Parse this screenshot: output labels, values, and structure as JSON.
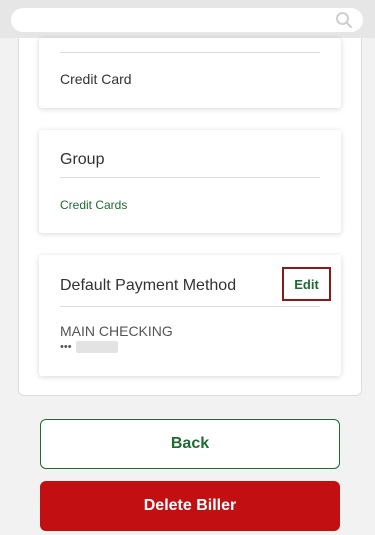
{
  "search": {
    "placeholder": ""
  },
  "category_card": {
    "value": "Credit Card"
  },
  "group_card": {
    "heading": "Group",
    "value": "Credit Cards"
  },
  "payment_card": {
    "heading": "Default Payment Method",
    "edit_label": "Edit",
    "account_name": "MAIN CHECKING",
    "account_mask": "•••"
  },
  "actions": {
    "back_label": "Back",
    "delete_label": "Delete Biller"
  },
  "colors": {
    "accent_green": "#1e6b34",
    "danger_red": "#c20f12",
    "focus_border": "#8a1a1a"
  }
}
